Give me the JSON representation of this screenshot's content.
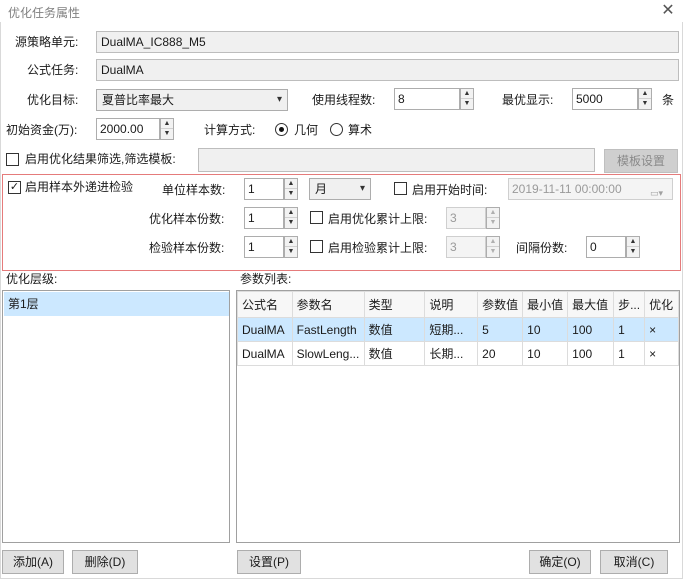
{
  "window": {
    "title": "优化任务属性",
    "close_glyph": "✕"
  },
  "form": {
    "source_unit_label": "源策略单元:",
    "source_unit_value": "DualMA_IC888_M5",
    "formula_label": "公式任务:",
    "formula_value": "DualMA",
    "target_label": "优化目标:",
    "target_value": "夏普比率最大",
    "threads_label": "使用线程数:",
    "threads_value": "8",
    "best_label": "最优显示:",
    "best_value": "5000",
    "best_unit": "条",
    "capital_label": "初始资金(万):",
    "capital_value": "2000.00",
    "calc_label": "计算方式:",
    "calc_geo": "几何",
    "calc_arith": "算术",
    "calc_selected": "几何",
    "filter_enable_label": "启用优化结果筛选,筛选模板:",
    "filter_enabled": false,
    "filter_template_value": "",
    "template_btn": "模板设置"
  },
  "sample": {
    "enable_label": "启用样本外递进检验",
    "enabled": true,
    "unit_count_label": "单位样本数:",
    "unit_count_value": "1",
    "unit_period_value": "月",
    "start_time_label": "启用开始时间:",
    "start_time_enabled": false,
    "start_time_value": "2019-11-11 00:00:00",
    "opt_count_label": "优化样本份数:",
    "opt_count_value": "1",
    "opt_limit_label": "启用优化累计上限:",
    "opt_limit_enabled": false,
    "opt_limit_value": "3",
    "test_count_label": "检验样本份数:",
    "test_count_value": "1",
    "test_limit_label": "启用检验累计上限:",
    "test_limit_enabled": false,
    "test_limit_value": "3",
    "interval_label": "间隔份数:",
    "interval_value": "0"
  },
  "levels": {
    "heading": "优化层级:",
    "items": [
      "第1层"
    ]
  },
  "params": {
    "heading": "参数列表:",
    "columns": [
      "公式名",
      "参数名",
      "类型",
      "说明",
      "参数值",
      "最小值",
      "最大值",
      "步...",
      "优化"
    ],
    "rows": [
      [
        "DualMA",
        "FastLength",
        "数值",
        "短期...",
        "5",
        "10",
        "100",
        "1",
        "×"
      ],
      [
        "DualMA",
        "SlowLeng...",
        "数值",
        "长期...",
        "20",
        "10",
        "100",
        "1",
        "×"
      ]
    ]
  },
  "buttons": {
    "add": "添加(A)",
    "delete": "删除(D)",
    "settings": "设置(P)",
    "ok": "确定(O)",
    "cancel": "取消(C)"
  },
  "icons": {
    "dropdown": "chevron-down-icon",
    "spin": "spin-arrows-icon",
    "calendar": "calendar-icon",
    "check": "checkmark-icon"
  }
}
